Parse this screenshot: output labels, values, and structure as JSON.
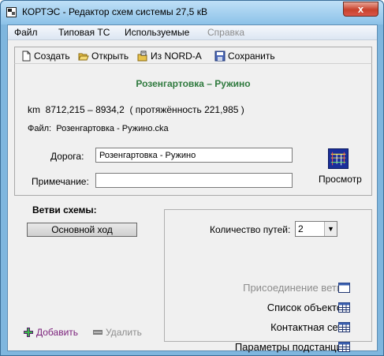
{
  "window": {
    "title": "КОРТЭС - Редактор схем системы 27,5 кВ",
    "close_glyph": "x"
  },
  "menu": {
    "items": [
      {
        "label": "Файл",
        "enabled": true
      },
      {
        "label": "Типовая ТС",
        "enabled": true
      },
      {
        "label": "Используемые",
        "enabled": true
      },
      {
        "label": "Справка",
        "enabled": false
      }
    ]
  },
  "toolbar": {
    "create": {
      "label": "Создать",
      "icon": "new-document-icon"
    },
    "open": {
      "label": "Открыть",
      "icon": "open-folder-icon"
    },
    "import": {
      "label": "Из NORD-A",
      "icon": "import-icon"
    },
    "save": {
      "label": "Сохранить",
      "icon": "save-icon"
    }
  },
  "route": {
    "title": "Розенгартовка – Ружино",
    "km_prefix": "km",
    "km_range": "8712,215 – 8934,2",
    "length_text": "( протяжённость 221,985 )",
    "file_label": "Файл:",
    "file_name": "Розенгартовка - Ружино.cka",
    "title_color": "#2f7a3e"
  },
  "form": {
    "road_label": "Дорога:",
    "road_value": "Розенгартовка - Ружино",
    "note_label": "Примечание:",
    "note_value": "",
    "preview_label": "Просмотр"
  },
  "branches": {
    "title": "Ветви схемы:",
    "items": [
      "Основной ход"
    ],
    "add_label": "Добавить",
    "delete_label": "Удалить"
  },
  "settings": {
    "paths_label": "Количество путей:",
    "paths_value": "2",
    "options": [
      {
        "label": "Присоединение ветви",
        "enabled": false,
        "icon": "window-icon"
      },
      {
        "label": "Список объектов",
        "enabled": true,
        "icon": "table-icon"
      },
      {
        "label": "Контактная сеть",
        "enabled": true,
        "icon": "table-icon"
      },
      {
        "label": "Параметры подстанций",
        "enabled": true,
        "icon": "table-icon"
      }
    ]
  }
}
